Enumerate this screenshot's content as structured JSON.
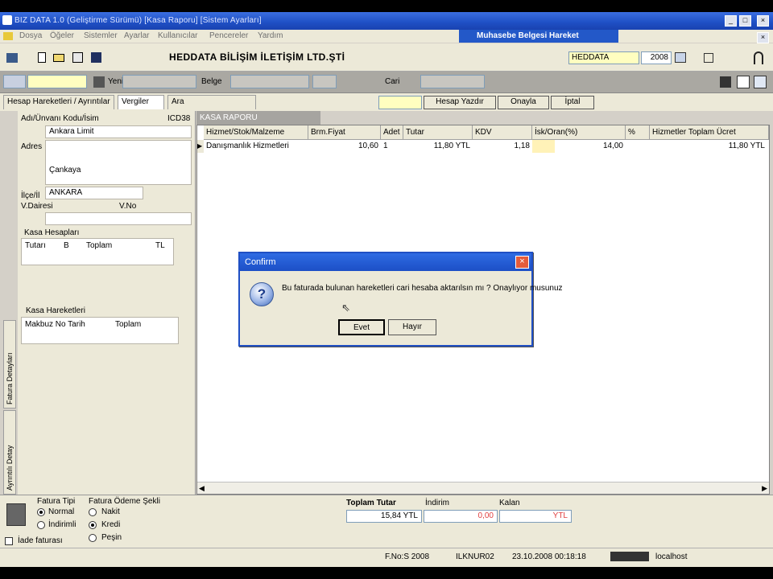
{
  "window": {
    "title": "BIZ DATA 1.0 (Geliştirme Sürümü) [Kasa Raporu] [Sistem Ayarları]",
    "panel_title": "Muhasebe Belgesi Hareket"
  },
  "menu": [
    "Dosya",
    "Öğeler",
    "Sistemler",
    "Ayarlar",
    "Kullanıcılar",
    "Pencereler",
    "Yardım"
  ],
  "company_title": "HEDDATA BİLİŞİM İLETİŞİM LTD.ŞTİ",
  "toolbar": {
    "company_code": "HEDDATA",
    "year": "2008"
  },
  "toolbar2": {
    "label_a": "Yenile",
    "label_b": "Belge",
    "label_c": "Cari"
  },
  "tabs": [
    "Hesap Hareketleri / Ayrıntılar",
    "Vergiler",
    "Ara"
  ],
  "right_buttons": [
    "Hesap Yazdır",
    "Onayla",
    "İptal"
  ],
  "left": {
    "account_header": "Adı/Ünvanı Kodu/İsim",
    "account_code": "ICD38",
    "name_label": "Adres",
    "name_value": "Ankara Limit",
    "address_value": "Çankaya",
    "city_label": "İlçe/İl",
    "city_value": "ANKARA",
    "tax_label": "V.Dairesi",
    "tax_no_label": "V.No",
    "group1_title": "Kasa Hesapları",
    "group1_cols": [
      "Tutarı",
      "B",
      "Toplam",
      "TL"
    ],
    "group2_title": "Kasa Hareketleri",
    "group2_cols": [
      "Makbuz No Tarih",
      "Toplam"
    ],
    "vtab1": "Fatura Detayları",
    "vtab2": "Ayrıntılı Detay"
  },
  "grid": {
    "title": "KASA RAPORU",
    "columns": [
      "Hizmet/Stok/Malzeme",
      "Brm.Fiyat",
      "Adet",
      "Tutar",
      "KDV",
      "İsk/Oran(%)",
      "%",
      "Hizmetler Toplam Ücret"
    ],
    "row": {
      "name": "Danışmanlık Hizmetleri",
      "price": "10,60",
      "qty": "1",
      "amount": "11,80 YTL",
      "kdv": "1,18",
      "rate": "14,00",
      "pct": "",
      "total": "11,80 YTL"
    }
  },
  "bottom": {
    "invoice_type_title": "Fatura Tipi",
    "invoice_types": [
      "Normal",
      "İndirimli"
    ],
    "payment_title": "Fatura Ödeme Şekli",
    "payment_types": [
      "Nakit",
      "Kredi",
      "Peşin"
    ],
    "checkbox_label": "İade faturası",
    "totals_title": "Toplam Tutar",
    "discount_title": "İndirim",
    "remaining_title": "Kalan",
    "total_value": "15,84 YTL",
    "discount_value": "0,00",
    "remaining_value": "YTL"
  },
  "status": {
    "version": "F.No:S 2008",
    "user": "ILKNUR02",
    "datetime": "23.10.2008 00:18:18",
    "server": "localhost"
  },
  "dialog": {
    "title": "Confirm",
    "message": "Bu faturada bulunan hareketleri cari hesaba aktarılsın mı ? Onaylıyor musunuz",
    "yes": "Evet",
    "no": "Hayır"
  }
}
